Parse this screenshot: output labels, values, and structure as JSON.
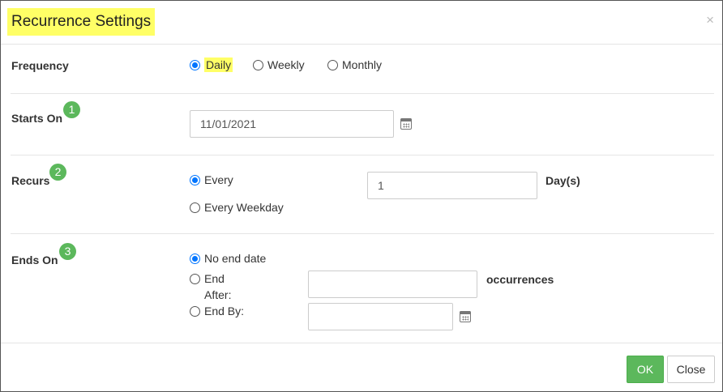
{
  "dialog": {
    "title": "Recurrence Settings",
    "close_glyph": "×"
  },
  "frequency": {
    "label": "Frequency",
    "options": [
      "Daily",
      "Weekly",
      "Monthly"
    ],
    "selected": "Daily"
  },
  "starts_on": {
    "label": "Starts On",
    "step": "1",
    "date_value": "11/01/2021"
  },
  "recurs": {
    "label": "Recurs",
    "step": "2",
    "every_label": "Every",
    "weekday_label": "Every Weekday",
    "selected": "Every",
    "interval_value": "1",
    "unit_label": "Day(s)"
  },
  "ends_on": {
    "label": "Ends On",
    "step": "3",
    "no_end_label": "No end date",
    "end_after_label_line1": "End",
    "end_after_label_line2": "After:",
    "end_by_label": "End By:",
    "selected": "No end date",
    "occurrences_value": "",
    "occurrences_label": "occurrences",
    "end_by_value": ""
  },
  "footer": {
    "ok_label": "OK",
    "close_label": "Close"
  },
  "colors": {
    "highlight": "#ffff66",
    "ok_button": "#5cb85c",
    "badge": "#5cb85c",
    "radio_checked": "#0075ff"
  },
  "icons": {
    "close": "close-icon",
    "calendar": "calendar-icon"
  }
}
